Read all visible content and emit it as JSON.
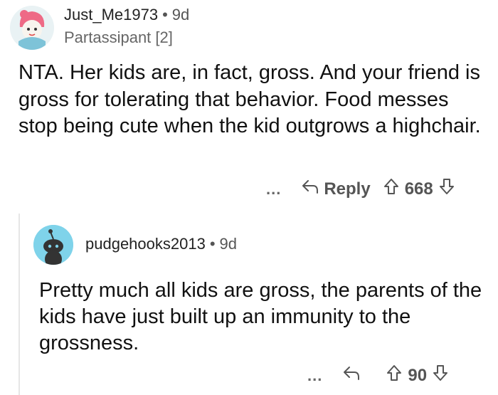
{
  "comment": {
    "username": "Just_Me1973",
    "age": "9d",
    "flair": "Partassipant [2]",
    "body": "NTA. Her kids are, in fact, gross. And your friend is gross for tolerating that behavior. Food messes stop being cute when the kid outgrows a highchair.",
    "more_label": "...",
    "reply_label": "Reply",
    "score": "668"
  },
  "reply": {
    "username": "pudgehooks2013",
    "age": "9d",
    "body": "Pretty much all kids are gross, the parents of the kids have just built up an immunity to the grossness.",
    "more_label": "...",
    "score": "90"
  },
  "colors": {
    "reply_avatar_bg": "#7fd3ea",
    "meta_text": "#555555"
  }
}
